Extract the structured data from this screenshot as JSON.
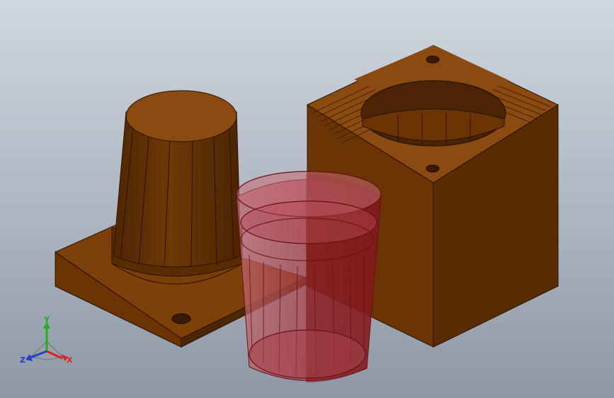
{
  "viewport": {
    "background_top": "#cfd6df",
    "background_bottom": "#8f99a6"
  },
  "model": {
    "body_color": "#7a3f08",
    "body_dark": "#5a2c04",
    "body_light": "#9a5516",
    "cup_color": "#b8505a",
    "cup_edge": "#6a0e12"
  },
  "triad": {
    "x_label": "X",
    "y_label": "Y",
    "z_label": "Z",
    "x_color": "#e02020",
    "y_color": "#20b020",
    "z_color": "#2040d0"
  }
}
